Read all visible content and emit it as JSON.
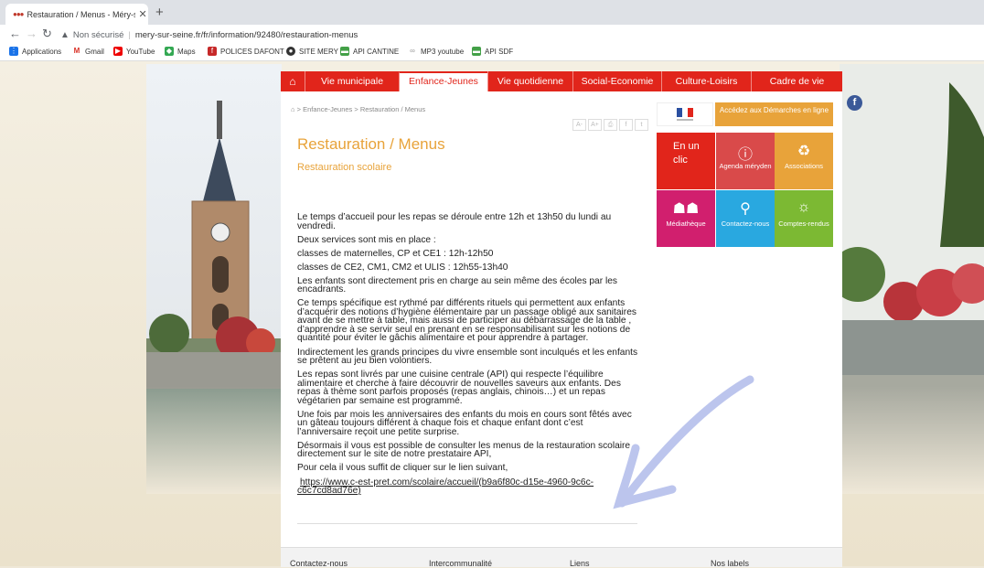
{
  "browser": {
    "tab_title": "Restauration / Menus - Méry-su",
    "new_tab": "+",
    "not_secure": "Non sécurisé",
    "url": "mery-sur-seine.fr/fr/information/92480/restauration-menus",
    "bookmarks": [
      "Applications",
      "Gmail",
      "YouTube",
      "Maps",
      "POLICES DAFONT",
      "SITE MERY",
      "API CANTINE",
      "MP3 youtube",
      "API SDF"
    ]
  },
  "nav": {
    "items": [
      "Vie municipale",
      "Enfance-Jeunes",
      "Vie quotidienne",
      "Social-Economie",
      "Culture-Loisirs",
      "Cadre de vie"
    ],
    "active_index": 1
  },
  "breadcrumb": "> Enfance-Jeunes > Restauration / Menus",
  "tools": [
    "A-",
    "A+",
    "⎙",
    "f",
    "t"
  ],
  "page": {
    "title": "Restauration / Menus",
    "subtitle": "Restauration scolaire",
    "paragraphs": [
      "Le temps d’accueil pour les repas se déroule entre 12h et 13h50 du lundi au vendredi.",
      "Deux services sont mis en place :",
      "classes de maternelles, CP et CE1 : 12h-12h50",
      "classes de CE2, CM1, CM2 et ULIS : 12h55-13h40",
      "Les enfants sont directement pris en charge au sein même des écoles par les encadrants.",
      "Ce temps spécifique est rythmé par différents rituels qui permettent aux enfants d’acquérir des notions d’hygiène élémentaire par un passage obligé aux sanitaires avant de se mettre à table, mais aussi de participer  au débarrassage de la table , d’apprendre à se servir seul en prenant en se responsabilisant sur les notions de quantité pour éviter le gâchis alimentaire et pour apprendre à partager.",
      "Indirectement les grands principes du vivre ensemble sont inculqués et les enfants se prêtent au jeu bien volontiers.",
      "Les repas sont livrés par une cuisine centrale (API) qui respecte l’équilibre alimentaire et cherche à faire découvrir de nouvelles saveurs aux enfants. Des repas à thème sont parfois proposés (repas anglais, chinois…) et un repas végétarien par semaine est programmé.",
      "Une fois par mois les anniversaires des enfants du mois en cours sont fêtés avec un gâteau toujours différent à chaque fois et chaque enfant dont c’est l’anniversaire reçoit une petite surprise.",
      "Désormais il vous est possible de consulter les menus de la restauration scolaire directement sur le site de notre prestataire API,",
      "Pour cela il vous suffit de cliquer sur le lien suivant,"
    ],
    "link": "https://www.c-est-pret.com/scolaire/accueil/(b9a6f80c-d15e-4960-9c6c-c6c7cd8ad76e)"
  },
  "sidebar": {
    "demarches": "Accédez aux Démarches en ligne",
    "tiles": [
      {
        "label": "En un clic",
        "color": "#e1251b",
        "icon": "click-text"
      },
      {
        "label": "Agenda méryden",
        "color": "#d94a4a",
        "icon": "info-icon"
      },
      {
        "label": "Associations",
        "color": "#e8a33a",
        "icon": "recycle-icon"
      },
      {
        "label": "Médiathèque",
        "color": "#d11f6e",
        "icon": "people-icon"
      },
      {
        "label": "Contactez-nous",
        "color": "#29a8e0",
        "icon": "search-icon"
      },
      {
        "label": "Comptes-rendus",
        "color": "#7cb933",
        "icon": "bulb-icon"
      }
    ]
  },
  "footer": [
    "Contactez-nous",
    "Intercommunalité",
    "Liens",
    "Nos labels"
  ]
}
